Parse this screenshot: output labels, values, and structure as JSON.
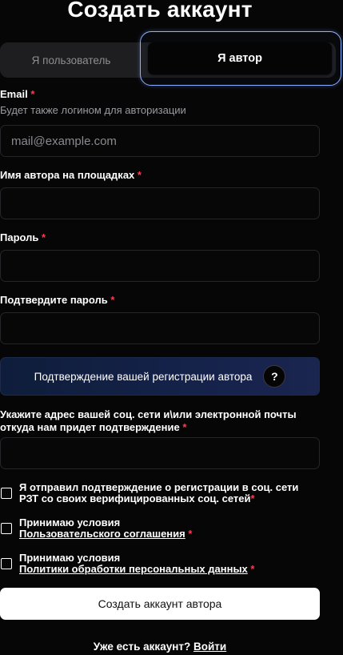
{
  "title": "Создать аккаунт",
  "tabs": {
    "user": "Я пользователь",
    "author": "Я автор",
    "active": "author"
  },
  "email": {
    "label": "Email",
    "required_mark": "*",
    "hint": "Будет также логином для авторизации",
    "placeholder": "mail@example.com",
    "value": ""
  },
  "author_name": {
    "label": "Имя автора на площадках",
    "required_mark": "*",
    "value": ""
  },
  "password": {
    "label": "Пароль",
    "required_mark": "*",
    "value": ""
  },
  "password_confirm": {
    "label": "Подтвердите пароль",
    "required_mark": "*",
    "value": ""
  },
  "confirmation": {
    "label": "Подтверждение вашей регистрации автора",
    "help_icon": "?"
  },
  "social": {
    "label_line1": "Укажите адрес вашей соц. сети и\\или электронной почты",
    "label_line2": "откуда нам придет подтверждение",
    "required_mark": "*",
    "value": ""
  },
  "checkboxes": [
    {
      "line1": "Я отправил подтверждение о регистрации в соц. сети",
      "line2": "РЗТ со своих верифицированных соц. сетей",
      "required_mark": "*",
      "checked": false
    },
    {
      "line1": "Принимаю условия",
      "link": "Пользовательского соглашения",
      "required_mark": "*",
      "checked": false
    },
    {
      "line1": "Принимаю условия",
      "link": "Политики обработки персональных данных",
      "required_mark": "*",
      "checked": false
    }
  ],
  "submit_label": "Создать аккаунт автора",
  "footer": {
    "question": "Уже есть аккаунт?",
    "login_link": "Войти"
  },
  "colors": {
    "background": "#060607",
    "required": "#ff3b4f",
    "tab_highlight": "#8fb0ff",
    "confirm_gradient": "#15224a"
  }
}
